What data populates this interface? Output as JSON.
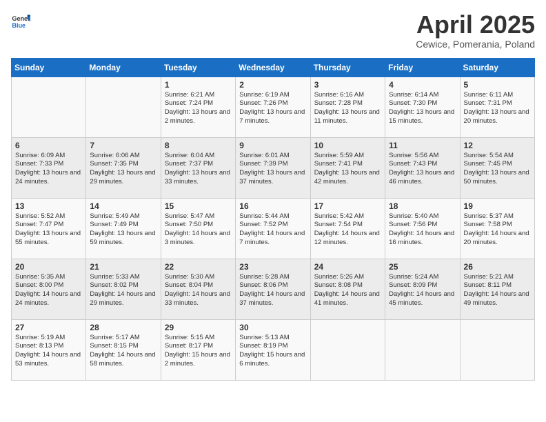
{
  "header": {
    "logo_general": "General",
    "logo_blue": "Blue",
    "title": "April 2025",
    "subtitle": "Cewice, Pomerania, Poland"
  },
  "weekdays": [
    "Sunday",
    "Monday",
    "Tuesday",
    "Wednesday",
    "Thursday",
    "Friday",
    "Saturday"
  ],
  "weeks": [
    [
      {
        "day": "",
        "content": ""
      },
      {
        "day": "",
        "content": ""
      },
      {
        "day": "1",
        "content": "Sunrise: 6:21 AM\nSunset: 7:24 PM\nDaylight: 13 hours and 2 minutes."
      },
      {
        "day": "2",
        "content": "Sunrise: 6:19 AM\nSunset: 7:26 PM\nDaylight: 13 hours and 7 minutes."
      },
      {
        "day": "3",
        "content": "Sunrise: 6:16 AM\nSunset: 7:28 PM\nDaylight: 13 hours and 11 minutes."
      },
      {
        "day": "4",
        "content": "Sunrise: 6:14 AM\nSunset: 7:30 PM\nDaylight: 13 hours and 15 minutes."
      },
      {
        "day": "5",
        "content": "Sunrise: 6:11 AM\nSunset: 7:31 PM\nDaylight: 13 hours and 20 minutes."
      }
    ],
    [
      {
        "day": "6",
        "content": "Sunrise: 6:09 AM\nSunset: 7:33 PM\nDaylight: 13 hours and 24 minutes."
      },
      {
        "day": "7",
        "content": "Sunrise: 6:06 AM\nSunset: 7:35 PM\nDaylight: 13 hours and 29 minutes."
      },
      {
        "day": "8",
        "content": "Sunrise: 6:04 AM\nSunset: 7:37 PM\nDaylight: 13 hours and 33 minutes."
      },
      {
        "day": "9",
        "content": "Sunrise: 6:01 AM\nSunset: 7:39 PM\nDaylight: 13 hours and 37 minutes."
      },
      {
        "day": "10",
        "content": "Sunrise: 5:59 AM\nSunset: 7:41 PM\nDaylight: 13 hours and 42 minutes."
      },
      {
        "day": "11",
        "content": "Sunrise: 5:56 AM\nSunset: 7:43 PM\nDaylight: 13 hours and 46 minutes."
      },
      {
        "day": "12",
        "content": "Sunrise: 5:54 AM\nSunset: 7:45 PM\nDaylight: 13 hours and 50 minutes."
      }
    ],
    [
      {
        "day": "13",
        "content": "Sunrise: 5:52 AM\nSunset: 7:47 PM\nDaylight: 13 hours and 55 minutes."
      },
      {
        "day": "14",
        "content": "Sunrise: 5:49 AM\nSunset: 7:49 PM\nDaylight: 13 hours and 59 minutes."
      },
      {
        "day": "15",
        "content": "Sunrise: 5:47 AM\nSunset: 7:50 PM\nDaylight: 14 hours and 3 minutes."
      },
      {
        "day": "16",
        "content": "Sunrise: 5:44 AM\nSunset: 7:52 PM\nDaylight: 14 hours and 7 minutes."
      },
      {
        "day": "17",
        "content": "Sunrise: 5:42 AM\nSunset: 7:54 PM\nDaylight: 14 hours and 12 minutes."
      },
      {
        "day": "18",
        "content": "Sunrise: 5:40 AM\nSunset: 7:56 PM\nDaylight: 14 hours and 16 minutes."
      },
      {
        "day": "19",
        "content": "Sunrise: 5:37 AM\nSunset: 7:58 PM\nDaylight: 14 hours and 20 minutes."
      }
    ],
    [
      {
        "day": "20",
        "content": "Sunrise: 5:35 AM\nSunset: 8:00 PM\nDaylight: 14 hours and 24 minutes."
      },
      {
        "day": "21",
        "content": "Sunrise: 5:33 AM\nSunset: 8:02 PM\nDaylight: 14 hours and 29 minutes."
      },
      {
        "day": "22",
        "content": "Sunrise: 5:30 AM\nSunset: 8:04 PM\nDaylight: 14 hours and 33 minutes."
      },
      {
        "day": "23",
        "content": "Sunrise: 5:28 AM\nSunset: 8:06 PM\nDaylight: 14 hours and 37 minutes."
      },
      {
        "day": "24",
        "content": "Sunrise: 5:26 AM\nSunset: 8:08 PM\nDaylight: 14 hours and 41 minutes."
      },
      {
        "day": "25",
        "content": "Sunrise: 5:24 AM\nSunset: 8:09 PM\nDaylight: 14 hours and 45 minutes."
      },
      {
        "day": "26",
        "content": "Sunrise: 5:21 AM\nSunset: 8:11 PM\nDaylight: 14 hours and 49 minutes."
      }
    ],
    [
      {
        "day": "27",
        "content": "Sunrise: 5:19 AM\nSunset: 8:13 PM\nDaylight: 14 hours and 53 minutes."
      },
      {
        "day": "28",
        "content": "Sunrise: 5:17 AM\nSunset: 8:15 PM\nDaylight: 14 hours and 58 minutes."
      },
      {
        "day": "29",
        "content": "Sunrise: 5:15 AM\nSunset: 8:17 PM\nDaylight: 15 hours and 2 minutes."
      },
      {
        "day": "30",
        "content": "Sunrise: 5:13 AM\nSunset: 8:19 PM\nDaylight: 15 hours and 6 minutes."
      },
      {
        "day": "",
        "content": ""
      },
      {
        "day": "",
        "content": ""
      },
      {
        "day": "",
        "content": ""
      }
    ]
  ]
}
